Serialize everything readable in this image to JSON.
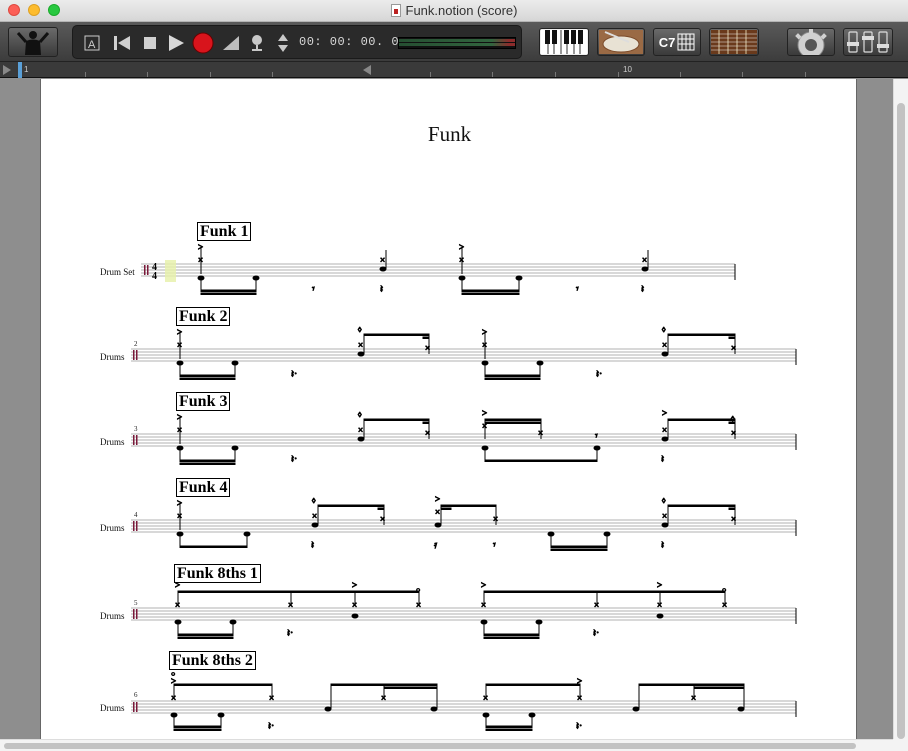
{
  "window": {
    "title": "Funk.notion (score)"
  },
  "toolbar": {
    "time": "00: 00: 00. 00",
    "chord_label": "C7",
    "colors": {
      "record": "#d8141c",
      "accent": "#5aa0d8"
    }
  },
  "ruler": {
    "start": "1",
    "marker": "10"
  },
  "score": {
    "title": "Funk",
    "systems": [
      {
        "label": "Funk 1",
        "instrument": "Drum Set",
        "measure": "",
        "time_signature_top": "4",
        "time_signature_bottom": "4"
      },
      {
        "label": "Funk 2",
        "instrument": "Drums",
        "measure": "2"
      },
      {
        "label": "Funk 3",
        "instrument": "Drums",
        "measure": "3"
      },
      {
        "label": "Funk 4",
        "instrument": "Drums",
        "measure": "4"
      },
      {
        "label": "Funk 8ths 1",
        "instrument": "Drums",
        "measure": "5"
      },
      {
        "label": "Funk 8ths 2",
        "instrument": "Drums",
        "measure": "6"
      }
    ]
  },
  "icons": [
    "conductor-icon",
    "text-a-icon",
    "rewind-icon",
    "stop-icon",
    "play-icon",
    "record-icon",
    "volume-ramp-icon",
    "mic-icon",
    "up-down-arrows-icon",
    "keyboard-icon",
    "drum-pad-icon",
    "chord-grid-icon",
    "guitar-fretboard-icon",
    "gear-icon",
    "mixer-icon"
  ]
}
